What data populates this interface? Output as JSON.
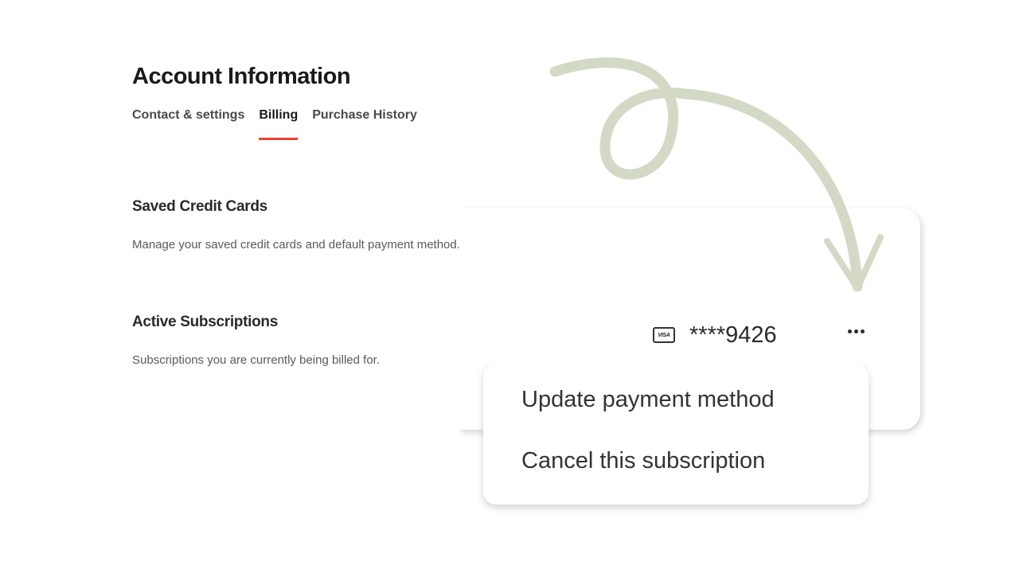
{
  "header": {
    "title": "Account Information"
  },
  "tabs": [
    {
      "label": "Contact & settings",
      "active": false
    },
    {
      "label": "Billing",
      "active": true
    },
    {
      "label": "Purchase History",
      "active": false
    }
  ],
  "saved_cards": {
    "title": "Saved Credit Cards",
    "description": "Manage your saved credit cards and default payment method."
  },
  "subscriptions": {
    "title": "Active Subscriptions",
    "description": "Subscriptions you are currently being billed for."
  },
  "payment_card": {
    "brand_icon": "visa-card-icon",
    "brand_text": "VISA",
    "number": "****9426",
    "more_icon": "more-horizontal-icon"
  },
  "menu": {
    "items": [
      {
        "label": "Update payment method"
      },
      {
        "label": "Cancel this subscription"
      }
    ]
  },
  "colors": {
    "accent": "#e8432e",
    "arrow": "#d4d9c6"
  }
}
